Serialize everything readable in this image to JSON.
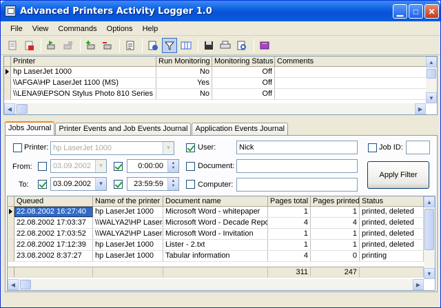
{
  "window": {
    "title": "Advanced Printers Activity Logger 1.0"
  },
  "menu": [
    "File",
    "View",
    "Commands",
    "Options",
    "Help"
  ],
  "printers": {
    "headers": [
      "Printer",
      "Run Monitoring",
      "Monitoring Status",
      "Comments"
    ],
    "rows": [
      [
        "hp LaserJet 1000",
        "No",
        "Off",
        ""
      ],
      [
        "\\\\AFGA\\HP LaserJet 1100 (MS)",
        "Yes",
        "Off",
        ""
      ],
      [
        "\\\\LENA9\\EPSON Stylus Photo 810 Series",
        "No",
        "Off",
        ""
      ]
    ]
  },
  "tabs": [
    "Jobs Journal",
    "Printer Events and Job Events Journal",
    "Application Events Journal"
  ],
  "filter": {
    "printer_label": "Printer:",
    "printer_value": "hp LaserJet 1000",
    "user_label": "User:",
    "user_value": "Nick",
    "jobid_label": "Job ID:",
    "jobid_value": "",
    "from_label": "From:",
    "from_date": "03.09.2002",
    "from_time": "0:00:00",
    "to_label": "To:",
    "to_date": "03.09.2002",
    "to_time": "23:59:59",
    "document_label": "Document:",
    "document_value": "",
    "computer_label": "Computer:",
    "computer_value": "",
    "apply_label": "Apply Filter"
  },
  "jobs": {
    "headers": [
      "Queued",
      "Name of the printer",
      "Document name",
      "Pages total",
      "Pages printed",
      "Status"
    ],
    "rows": [
      [
        "22.08.2002 16:27:40",
        "hp LaserJet 1000",
        "Microsoft Word - whitepaper",
        "1",
        "1",
        "printed, deleted"
      ],
      [
        "22.08.2002 17:03:37",
        "\\\\WALYA2\\HP LaserJet",
        "Microsoft Word - Decade Report",
        "4",
        "4",
        "printed, deleted"
      ],
      [
        "22.08.2002 17:03:52",
        "\\\\WALYA2\\HP LaserJet",
        "Microsoft Word - Invitation",
        "1",
        "1",
        "printed, deleted"
      ],
      [
        "22.08.2002 17:12:39",
        "hp LaserJet 1000",
        "Lister - 2.txt",
        "1",
        "1",
        "printed, deleted"
      ],
      [
        "23.08.2002 8:37:27",
        "hp LaserJet 1000",
        "Tabular information",
        "4",
        "0",
        "printing"
      ]
    ],
    "totals": {
      "pages_total": "311",
      "pages_printed": "247"
    }
  }
}
